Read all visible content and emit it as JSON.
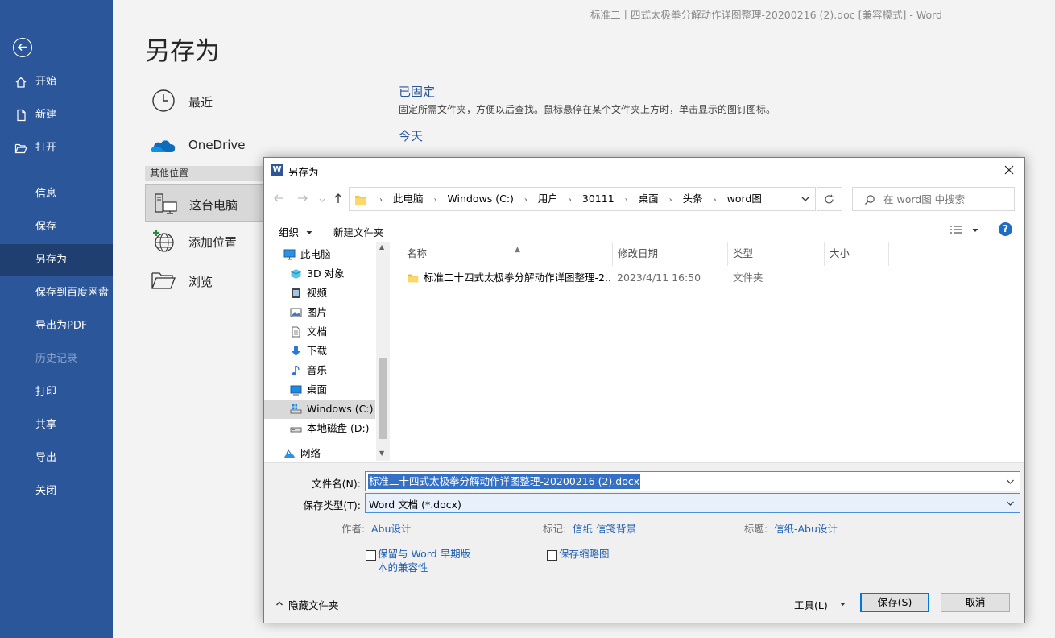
{
  "window_title": "标准二十四式太极拳分解动作详图整理-20200216 (2).doc [兼容模式]  -  Word",
  "sidebar": {
    "items": [
      {
        "label": "开始",
        "icon": "home-icon"
      },
      {
        "label": "新建",
        "icon": "new-document-icon"
      },
      {
        "label": "打开",
        "icon": "open-folder-icon"
      },
      {
        "label": "信息"
      },
      {
        "label": "保存"
      },
      {
        "label": "另存为",
        "selected": true
      },
      {
        "label": "保存到百度网盘"
      },
      {
        "label": "导出为PDF"
      },
      {
        "label": "历史记录",
        "disabled": true
      },
      {
        "label": "打印"
      },
      {
        "label": "共享"
      },
      {
        "label": "导出"
      },
      {
        "label": "关闭"
      }
    ]
  },
  "backstage": {
    "title": "另存为",
    "locations": [
      {
        "label": "最近",
        "icon": "clock-icon"
      },
      {
        "label": "OneDrive",
        "icon": "onedrive-cloud-icon"
      },
      {
        "label": "这台电脑",
        "icon": "this-pc-icon",
        "selected": true
      },
      {
        "label": "添加位置",
        "icon": "add-place-globe-icon"
      },
      {
        "label": "浏览",
        "icon": "browse-folder-icon"
      }
    ],
    "other_locations_header": "其他位置",
    "pinned_title": "已固定",
    "pinned_desc": "固定所需文件夹，方便以后查找。鼠标悬停在某个文件夹上方时，单击显示的图钉图标。",
    "today_title": "今天"
  },
  "dialog": {
    "title": "另存为",
    "breadcrumbs": [
      "此电脑",
      "Windows (C:)",
      "用户",
      "30111",
      "桌面",
      "头条",
      "word图"
    ],
    "search_placeholder": "在 word图 中搜索",
    "organize_label": "组织",
    "new_folder_label": "新建文件夹",
    "help_label": "?",
    "tree": [
      {
        "label": "此电脑",
        "icon": "computer-icon",
        "level": 0
      },
      {
        "label": "3D 对象",
        "icon": "3d-objects-icon",
        "level": 1
      },
      {
        "label": "视频",
        "icon": "video-icon",
        "level": 1
      },
      {
        "label": "图片",
        "icon": "pictures-icon",
        "level": 1
      },
      {
        "label": "文档",
        "icon": "documents-icon",
        "level": 1
      },
      {
        "label": "下载",
        "icon": "downloads-icon",
        "level": 1
      },
      {
        "label": "音乐",
        "icon": "music-icon",
        "level": 1
      },
      {
        "label": "桌面",
        "icon": "desktop-icon",
        "level": 1
      },
      {
        "label": "Windows (C:)",
        "icon": "windows-drive-icon",
        "level": 1,
        "selected": true
      },
      {
        "label": "本地磁盘 (D:)",
        "icon": "local-disk-icon",
        "level": 1
      },
      {
        "label": "网络",
        "icon": "network-icon",
        "level": 0
      }
    ],
    "columns": [
      "名称",
      "修改日期",
      "类型",
      "大小"
    ],
    "files": [
      {
        "name": "标准二十四式太极拳分解动作详图整理-2...",
        "date": "2023/4/11 16:50",
        "type": "文件夹",
        "size": ""
      }
    ],
    "filename_label": "文件名(N):",
    "filename_value": "标准二十四式太极拳分解动作详图整理-20200216 (2).docx",
    "filetype_label": "保存类型(T):",
    "filetype_value": "Word 文档 (*.docx)",
    "author_label": "作者:",
    "author_value": "Abu设计",
    "tags_label": "标记:",
    "tags_value": "信纸 信笺背景",
    "subject_label": "标题:",
    "subject_value": "信纸-Abu设计",
    "compat_line1": "保留与 Word 早期版",
    "compat_line2": "本的兼容性",
    "thumbnail_label": "保存缩略图",
    "hide_folders_label": "隐藏文件夹",
    "tools_label": "工具(L)",
    "save_label": "保存(S)",
    "cancel_label": "取消"
  }
}
